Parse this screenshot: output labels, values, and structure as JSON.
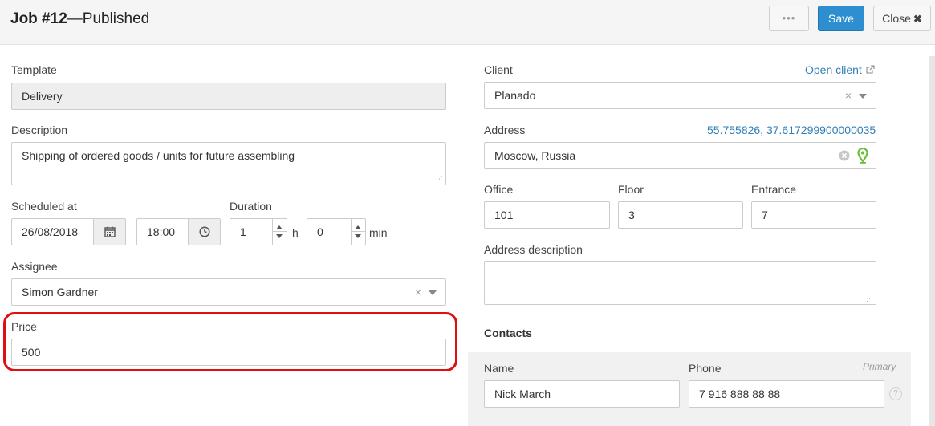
{
  "header": {
    "job_number": "Job #12",
    "status": "—Published",
    "more_label": "•••",
    "save_label": "Save",
    "close_label": "Close"
  },
  "template": {
    "label": "Template",
    "value": "Delivery"
  },
  "description": {
    "label": "Description",
    "value": "Shipping of ordered goods / units for future assembling"
  },
  "scheduled": {
    "label": "Scheduled at",
    "date": "26/08/2018",
    "time": "18:00"
  },
  "duration": {
    "label": "Duration",
    "hours": "1",
    "hours_unit": "h",
    "minutes": "0",
    "minutes_unit": "min"
  },
  "assignee": {
    "label": "Assignee",
    "value": "Simon Gardner"
  },
  "price": {
    "label": "Price",
    "value": "500"
  },
  "client": {
    "label": "Client",
    "value": "Planado",
    "open_link": "Open client"
  },
  "address": {
    "label": "Address",
    "value": "Moscow, Russia",
    "coordinates": "55.755826, 37.617299900000035"
  },
  "office": {
    "label": "Office",
    "value": "101"
  },
  "floor": {
    "label": "Floor",
    "value": "3"
  },
  "entrance": {
    "label": "Entrance",
    "value": "7"
  },
  "address_description": {
    "label": "Address description",
    "value": ""
  },
  "contacts": {
    "title": "Contacts",
    "name_label": "Name",
    "phone_label": "Phone",
    "primary_label": "Primary",
    "name": "Nick March",
    "phone": "7 916 888 88 88"
  },
  "colors": {
    "accent": "#2d8fd0",
    "highlight": "#e01010",
    "link": "#2f7fb6",
    "pin": "#6cbf3c"
  },
  "icons": [
    "calendar-icon",
    "clock-icon",
    "external-link-icon",
    "clear-icon",
    "map-pin-icon",
    "chevron-down-icon",
    "help-icon"
  ]
}
